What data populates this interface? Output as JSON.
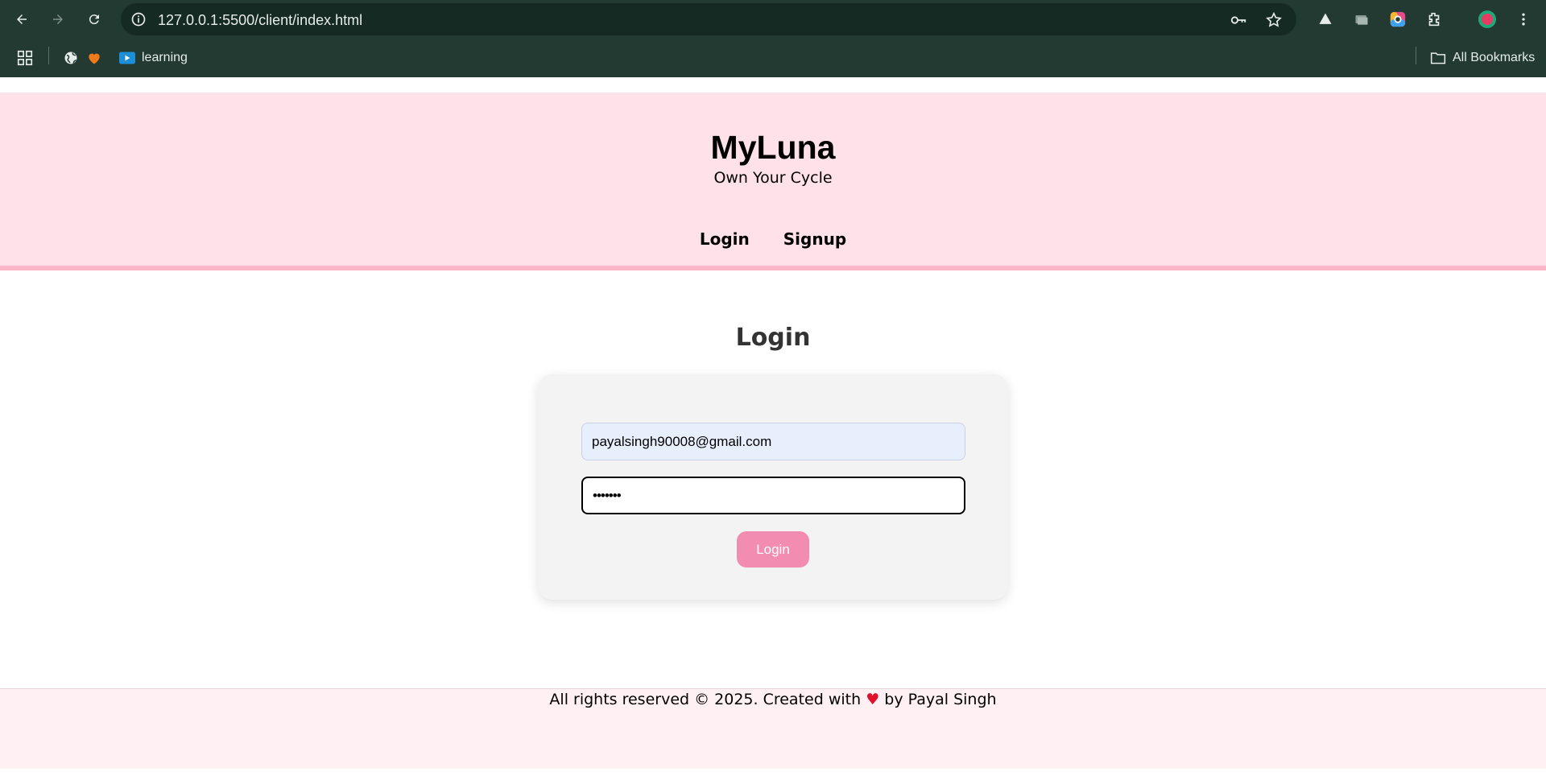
{
  "browser": {
    "url": "127.0.0.1:5500/client/index.html",
    "bookmarks": [
      {
        "label": "learning",
        "icon": "youtube-icon"
      }
    ],
    "all_bookmarks_label": "All Bookmarks",
    "icons": [
      "back-icon",
      "forward-icon",
      "reload-icon",
      "site-info-icon",
      "password-key-icon",
      "bookmark-star-icon",
      "apps-grid-icon",
      "globe-icon",
      "heart-icon",
      "folder-icon",
      "extensions-icon",
      "profile-avatar-icon",
      "menu-dots-icon"
    ]
  },
  "header": {
    "title": "MyLuna",
    "tagline": "Own Your Cycle",
    "nav": [
      {
        "label": "Login"
      },
      {
        "label": "Signup"
      }
    ]
  },
  "main": {
    "heading": "Login",
    "form": {
      "email_value": "payalsingh90008@gmail.com",
      "password_value": "•••••••",
      "submit_label": "Login"
    }
  },
  "footer": {
    "text_before": "All rights reserved © 2025. Created with",
    "heart": "♥",
    "text_after": "by Payal Singh"
  },
  "colors": {
    "chrome": "#233a33",
    "header_bg": "#ffe1ea",
    "header_border": "#ffb6c8",
    "button": "#f28cb1",
    "footer_bg": "#fff0f4",
    "heart": "#e0112b"
  }
}
